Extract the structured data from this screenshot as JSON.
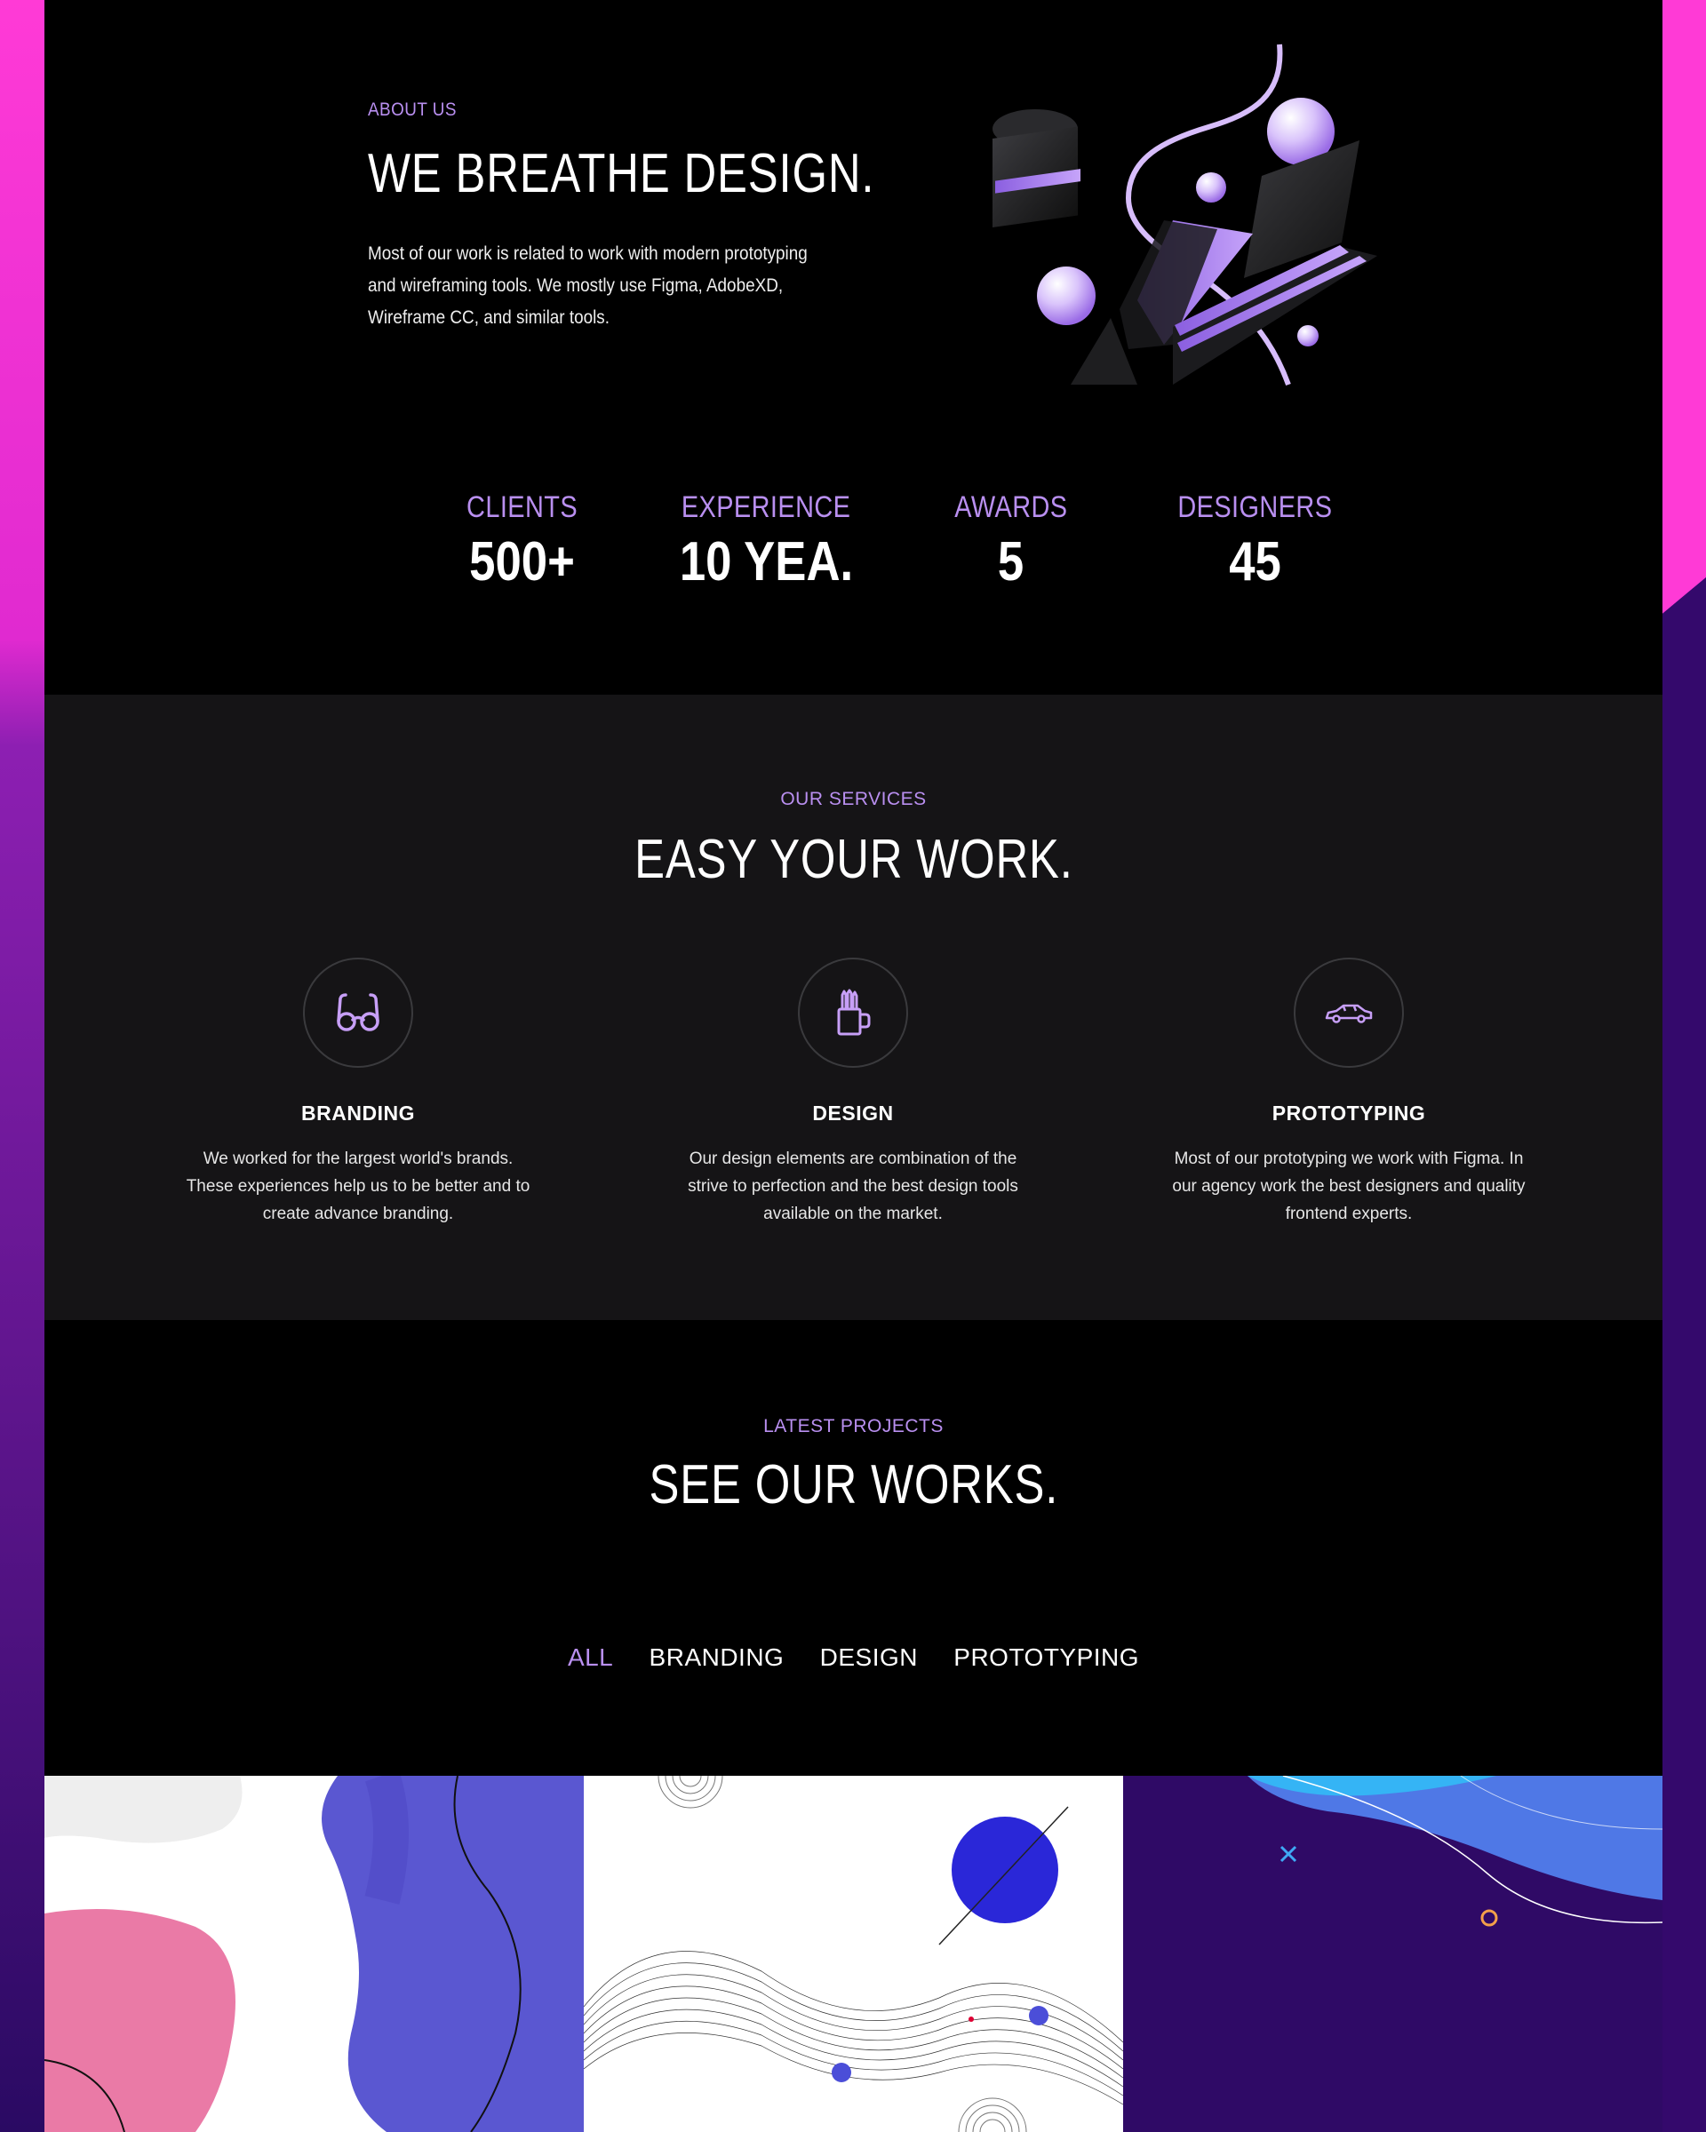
{
  "about": {
    "eyebrow": "ABOUT US",
    "title": "WE BREATHE DESIGN.",
    "text": "Most of our work is related to work with modern prototyping and wireframing tools. We mostly use Figma, AdobeXD, Wireframe CC, and similar tools."
  },
  "stats": [
    {
      "label": "CLIENTS",
      "value": "500+"
    },
    {
      "label": "EXPERIENCE",
      "value": "10 YEA."
    },
    {
      "label": "AWARDS",
      "value": "5"
    },
    {
      "label": "DESIGNERS",
      "value": "45"
    }
  ],
  "services": {
    "eyebrow": "OUR SERVICES",
    "title": "EASY YOUR WORK.",
    "items": [
      {
        "name": "BRANDING",
        "icon": "glasses-icon",
        "desc": "We worked for the largest world's brands. These experiences help us to be better and to create advance branding."
      },
      {
        "name": "DESIGN",
        "icon": "pencil-cup-icon",
        "desc": "Our design elements are combination of the strive to perfection and the best design tools available on the market."
      },
      {
        "name": "PROTOTYPING",
        "icon": "car-icon",
        "desc": "Most of our prototyping we work with Figma. In our agency work the best designers and quality frontend experts."
      }
    ]
  },
  "projects": {
    "eyebrow": "LATEST PROJECTS",
    "title": "SEE OUR WORKS.",
    "filters": [
      "ALL",
      "BRANDING",
      "DESIGN",
      "PROTOTYPING"
    ],
    "active_filter": "ALL"
  },
  "colors": {
    "accent": "#b98ff0",
    "pink": "#ff3ad6",
    "deep_purple": "#2a0a63"
  }
}
